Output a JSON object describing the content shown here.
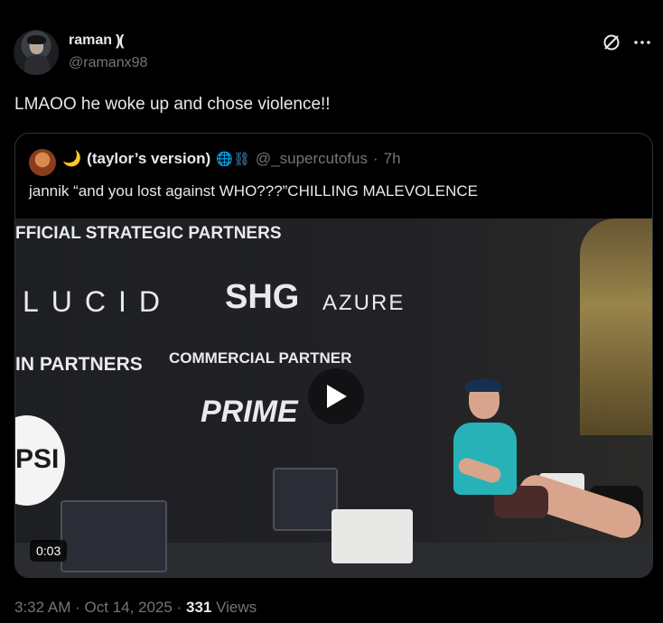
{
  "author": {
    "display_name": "raman",
    "handle": "@ramanx98"
  },
  "tweet": {
    "text": "LMAOO he woke up and chose violence!!"
  },
  "quote": {
    "emoji": "🌙",
    "display_name": "(taylor’s version)",
    "badges": "🌐⛓",
    "handle": "@_supercutofus",
    "separator": "·",
    "time": "7h",
    "text": "jannik “and you lost against WHO???”CHILLING MALEVOLENCE"
  },
  "video": {
    "duration": "0:03",
    "signage": {
      "official_partners": "FFICIAL STRATEGIC PARTNERS",
      "lucid": "LUCID",
      "shg": "SHG",
      "azure": "AZURE",
      "main_partners": "IN PARTNERS",
      "commercial_partner": "COMMERCIAL PARTNER",
      "prime": "PRIME",
      "pepsi": "PSI"
    }
  },
  "meta": {
    "time": "3:32 AM",
    "dot": "·",
    "date": "Oct 14, 2025",
    "views_count": "331",
    "views_label": "Views"
  },
  "icons": {
    "grok": "grok-icon",
    "more": "more-icon",
    "play": "play-icon"
  },
  "colors": {
    "background": "#000000",
    "text": "#e7e9ea",
    "muted": "#71767b",
    "border": "#2f3336"
  }
}
